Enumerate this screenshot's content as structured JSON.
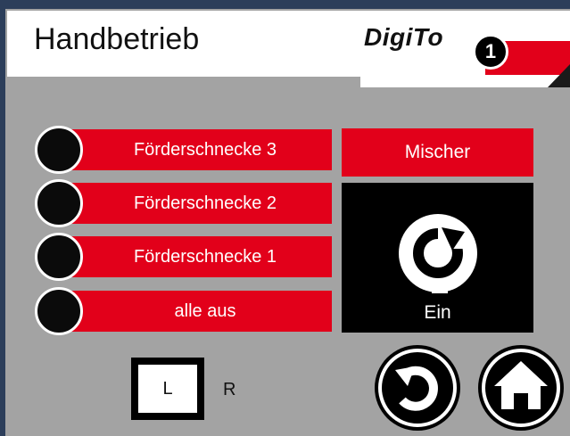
{
  "header": {
    "title": "Handbetrieb",
    "logo_text": "DigiTo",
    "badge": "1"
  },
  "rows": [
    {
      "label": "Förderschnecke 3"
    },
    {
      "label": "Förderschnecke 2"
    },
    {
      "label": "Förderschnecke 1"
    },
    {
      "label": "alle aus"
    }
  ],
  "mixer": {
    "label": "Mischer",
    "state_label": "Ein",
    "icon": "rotate-icon"
  },
  "side_select": {
    "left_label": "L",
    "right_label": "R"
  },
  "nav": {
    "back_icon": "back-icon",
    "home_icon": "home-icon"
  },
  "colors": {
    "accent_red": "#e2001a",
    "panel_gray": "#a3a3a3",
    "black": "#000000"
  }
}
